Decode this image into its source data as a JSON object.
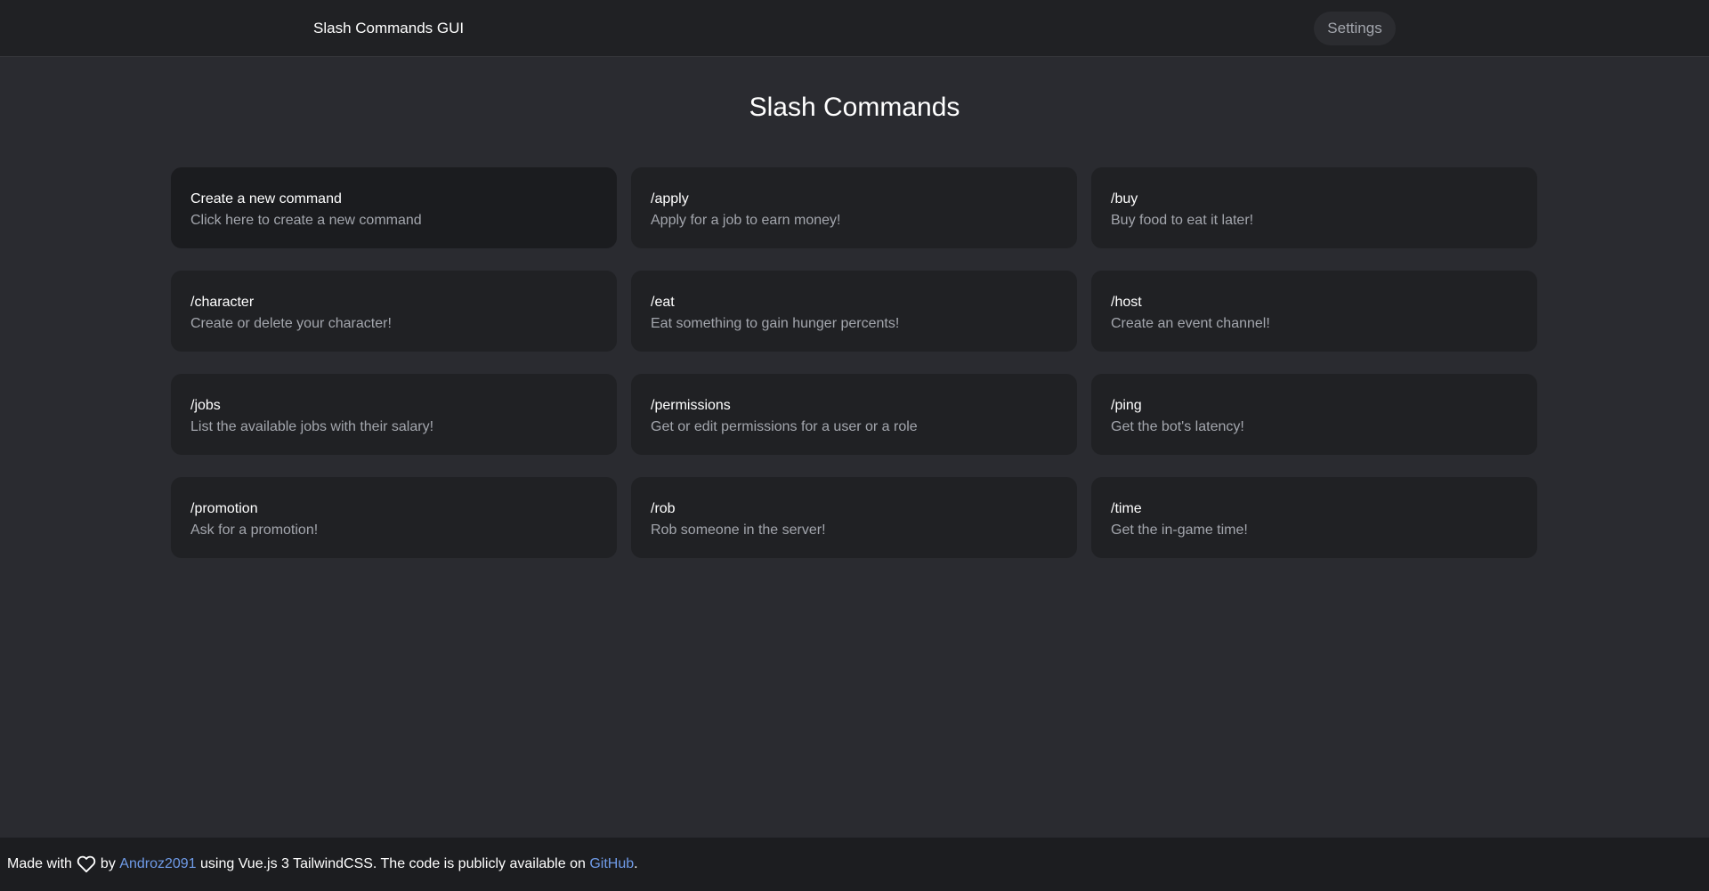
{
  "navbar": {
    "brand": "Slash Commands GUI",
    "settings_label": "Settings"
  },
  "main": {
    "title": "Slash Commands",
    "cards": [
      {
        "title": "Create a new command",
        "desc": "Click here to create a new command"
      },
      {
        "title": "/apply",
        "desc": "Apply for a job to earn money!"
      },
      {
        "title": "/buy",
        "desc": "Buy food to eat it later!"
      },
      {
        "title": "/character",
        "desc": "Create or delete your character!"
      },
      {
        "title": "/eat",
        "desc": "Eat something to gain hunger percents!"
      },
      {
        "title": "/host",
        "desc": "Create an event channel!"
      },
      {
        "title": "/jobs",
        "desc": "List the available jobs with their salary!"
      },
      {
        "title": "/permissions",
        "desc": "Get or edit permissions for a user or a role"
      },
      {
        "title": "/ping",
        "desc": "Get the bot's latency!"
      },
      {
        "title": "/promotion",
        "desc": "Ask for a promotion!"
      },
      {
        "title": "/rob",
        "desc": "Rob someone in the server!"
      },
      {
        "title": "/time",
        "desc": "Get the in-game time!"
      }
    ]
  },
  "footer": {
    "made_with": "Made with",
    "heart_icon": "heart-icon",
    "by": "by",
    "author": "Androz2091",
    "middle": "using Vue.js 3 TailwindCSS. The code is publicly available on",
    "github": "GitHub",
    "end": "."
  },
  "colors": {
    "background": "#2a2b30",
    "navbar": "#202124",
    "card": "#202124",
    "link": "#6f9be8",
    "muted_text": "#a3a6ad"
  }
}
